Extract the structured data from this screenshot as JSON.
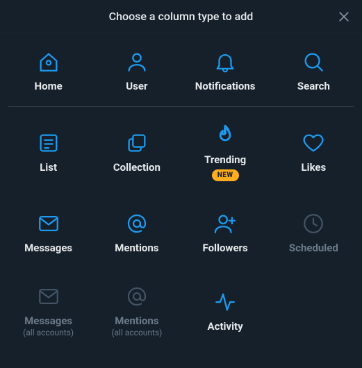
{
  "header": {
    "title": "Choose a column type to add"
  },
  "badge": {
    "new": "NEW"
  },
  "rows": [
    [
      {
        "id": "home",
        "label": "Home"
      },
      {
        "id": "user",
        "label": "User"
      },
      {
        "id": "notifications",
        "label": "Notifications"
      },
      {
        "id": "search",
        "label": "Search"
      }
    ],
    [
      {
        "id": "list",
        "label": "List"
      },
      {
        "id": "collection",
        "label": "Collection"
      },
      {
        "id": "trending",
        "label": "Trending",
        "badge": "NEW"
      },
      {
        "id": "likes",
        "label": "Likes"
      }
    ],
    [
      {
        "id": "messages",
        "label": "Messages"
      },
      {
        "id": "mentions",
        "label": "Mentions"
      },
      {
        "id": "followers",
        "label": "Followers"
      },
      {
        "id": "scheduled",
        "label": "Scheduled",
        "disabled": true
      }
    ],
    [
      {
        "id": "messages-all",
        "label": "Messages",
        "sublabel": "(all accounts)",
        "disabled": true
      },
      {
        "id": "mentions-all",
        "label": "Mentions",
        "sublabel": "(all accounts)",
        "disabled": true
      },
      {
        "id": "activity",
        "label": "Activity"
      }
    ]
  ],
  "colors": {
    "background": "#15202b",
    "accent": "#1d9bf0",
    "text": "#e7e9ea",
    "muted": "#6b7a89",
    "badge": "#ffad1f"
  }
}
